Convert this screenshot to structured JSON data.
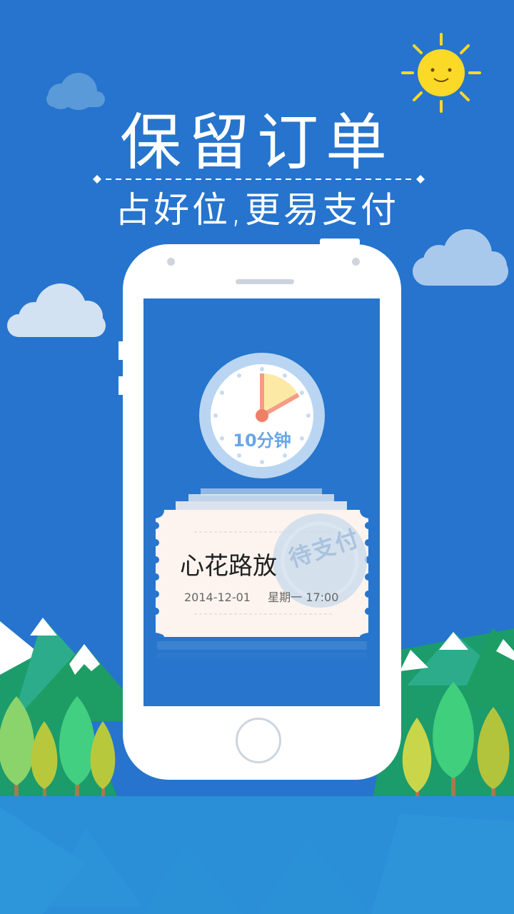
{
  "banner": {
    "title": "保留订单",
    "subtitle": "占好位,更易支付"
  },
  "clock": {
    "label": "10分钟"
  },
  "ticket": {
    "name": "心花路放",
    "date": "2014-12-01",
    "weekday_time": "星期一 17:00",
    "stamp": "待支付"
  },
  "colors": {
    "sky": "#2674cd",
    "accent_blue": "#6aa6e6",
    "sun": "#fbd927",
    "water": "#2a8fd6"
  }
}
